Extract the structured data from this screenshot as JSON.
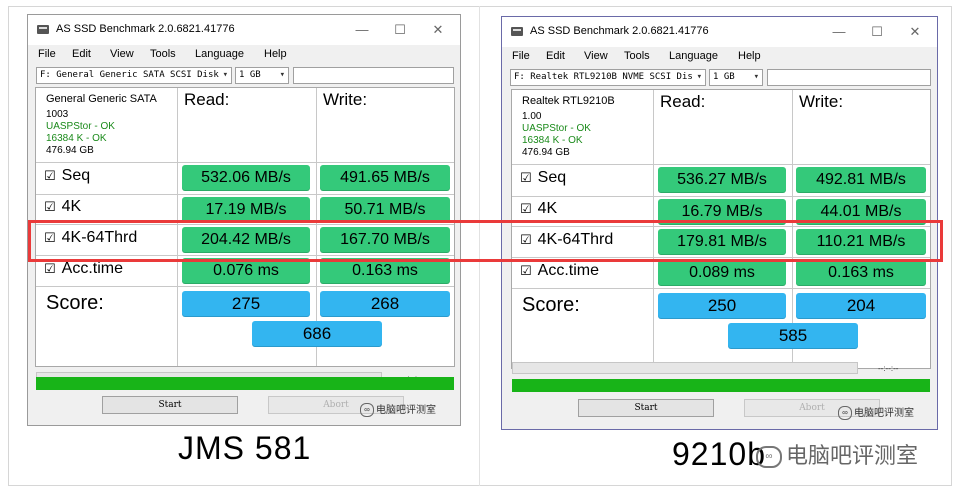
{
  "left": {
    "window_title": "AS SSD Benchmark 2.0.6821.41776",
    "menu": [
      "File",
      "Edit",
      "View",
      "Tools",
      "Language",
      "Help"
    ],
    "drive_select": "F: General Generic SATA SCSI Disk",
    "size_select": "1 GB",
    "info": {
      "name": "General Generic SATA",
      "firmware": "1003",
      "driver": "UASPStor - OK",
      "alignment": "16384 K - OK",
      "capacity": "476.94 GB"
    },
    "read_header": "Read:",
    "write_header": "Write:",
    "rows": [
      {
        "label": "Seq",
        "read": "532.06 MB/s",
        "write": "491.65 MB/s"
      },
      {
        "label": "4K",
        "read": "17.19 MB/s",
        "write": "50.71 MB/s"
      },
      {
        "label": "4K-64Thrd",
        "read": "204.42 MB/s",
        "write": "167.70 MB/s"
      },
      {
        "label": "Acc.time",
        "read": "0.076 ms",
        "write": "0.163 ms"
      }
    ],
    "score_label": "Score:",
    "score_read": "275",
    "score_write": "268",
    "score_total": "686",
    "elapsed": "--:--:--",
    "start_label": "Start",
    "abort_label": "Abort",
    "watermark": "电脑吧评测室",
    "caption": "JMS 581"
  },
  "right": {
    "window_title": "AS SSD Benchmark 2.0.6821.41776",
    "menu": [
      "File",
      "Edit",
      "View",
      "Tools",
      "Language",
      "Help"
    ],
    "drive_select": "F: Realtek RTL9210B NVME SCSI Dis",
    "size_select": "1 GB",
    "info": {
      "name": "Realtek RTL9210B",
      "firmware": "1.00",
      "driver": "UASPStor - OK",
      "alignment": "16384 K - OK",
      "capacity": "476.94 GB"
    },
    "read_header": "Read:",
    "write_header": "Write:",
    "rows": [
      {
        "label": "Seq",
        "read": "536.27 MB/s",
        "write": "492.81 MB/s"
      },
      {
        "label": "4K",
        "read": "16.79 MB/s",
        "write": "44.01 MB/s"
      },
      {
        "label": "4K-64Thrd",
        "read": "179.81 MB/s",
        "write": "110.21 MB/s"
      },
      {
        "label": "Acc.time",
        "read": "0.089 ms",
        "write": "0.163 ms"
      }
    ],
    "score_label": "Score:",
    "score_read": "250",
    "score_write": "204",
    "score_total": "585",
    "elapsed": "--:--:--",
    "start_label": "Start",
    "abort_label": "Abort",
    "watermark": "电脑吧评测室",
    "caption": "9210b"
  },
  "page_watermark": "电脑吧评测室",
  "colors": {
    "result_green": "#34c97a",
    "score_blue": "#33b5f0",
    "progress_green": "#18b418",
    "highlight_red": "#ea3a3a",
    "ok_green": "#1a8a1a"
  },
  "progress_fill": 1.0,
  "checkbox_icon": "☑"
}
